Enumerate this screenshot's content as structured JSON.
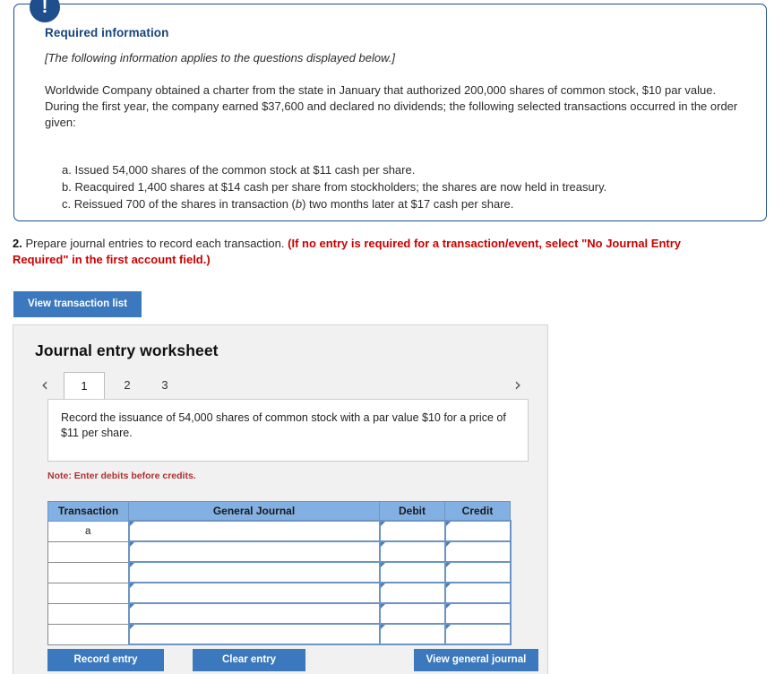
{
  "required_info": {
    "badge_icon": "exclamation-icon",
    "heading": "Required information",
    "applies_note": "[The following information applies to the questions displayed below.]",
    "scenario": "Worldwide Company obtained a charter from the state in January that authorized 200,000 shares of common stock, $10 par value. During the first year, the company earned $37,600 and declared no dividends; the following selected transactions occurred in the order given:",
    "transactions": [
      {
        "label": "a.",
        "text": "Issued 54,000 shares of the common stock at $11 cash per share."
      },
      {
        "label": "b.",
        "text": "Reacquired 1,400 shares at $14 cash per share from stockholders; the shares are now held in treasury."
      },
      {
        "label": "c_prefix",
        "text": "c. Reissued 700 of the shares in transaction ("
      },
      {
        "label": "c_italic",
        "text": "b"
      },
      {
        "label": "c_suffix",
        "text": ") two months later at $17 cash per share."
      }
    ]
  },
  "question": {
    "number": "2.",
    "text": " Prepare journal entries to record each transaction. ",
    "instruction": "(If no entry is required for a transaction/event, select \"No Journal Entry Required\" in the first account field.)"
  },
  "toolbar": {
    "view_transaction_list_label": "View transaction list"
  },
  "worksheet": {
    "title": "Journal entry worksheet",
    "prev_arrow": "chevron-left-icon",
    "next_arrow": "chevron-right-icon",
    "tabs": [
      {
        "label": "1",
        "active": true
      },
      {
        "label": "2",
        "active": false
      },
      {
        "label": "3",
        "active": false
      }
    ],
    "prompt": "Record the issuance of 54,000 shares of common stock with a par value $10 for a price of $11 per share.",
    "note": "Note: Enter debits before credits.",
    "table": {
      "headers": [
        "Transaction",
        "General Journal",
        "Debit",
        "Credit"
      ],
      "rows": [
        {
          "transaction": "a",
          "general_journal": "",
          "debit": "",
          "credit": ""
        },
        {
          "transaction": "",
          "general_journal": "",
          "debit": "",
          "credit": ""
        },
        {
          "transaction": "",
          "general_journal": "",
          "debit": "",
          "credit": ""
        },
        {
          "transaction": "",
          "general_journal": "",
          "debit": "",
          "credit": ""
        },
        {
          "transaction": "",
          "general_journal": "",
          "debit": "",
          "credit": ""
        },
        {
          "transaction": "",
          "general_journal": "",
          "debit": "",
          "credit": ""
        }
      ]
    },
    "buttons": {
      "record_entry": "Record entry",
      "clear_entry": "Clear entry",
      "view_general_journal": "View general journal"
    }
  },
  "colors": {
    "callout_border": "#1f4e8c",
    "heading_blue": "#16447e",
    "button_blue": "#3c78bd",
    "instruction_red": "#cc0000",
    "note_red": "#b03030",
    "table_header_blue": "#83b0e3",
    "panel_gray": "#f1f1f1"
  }
}
